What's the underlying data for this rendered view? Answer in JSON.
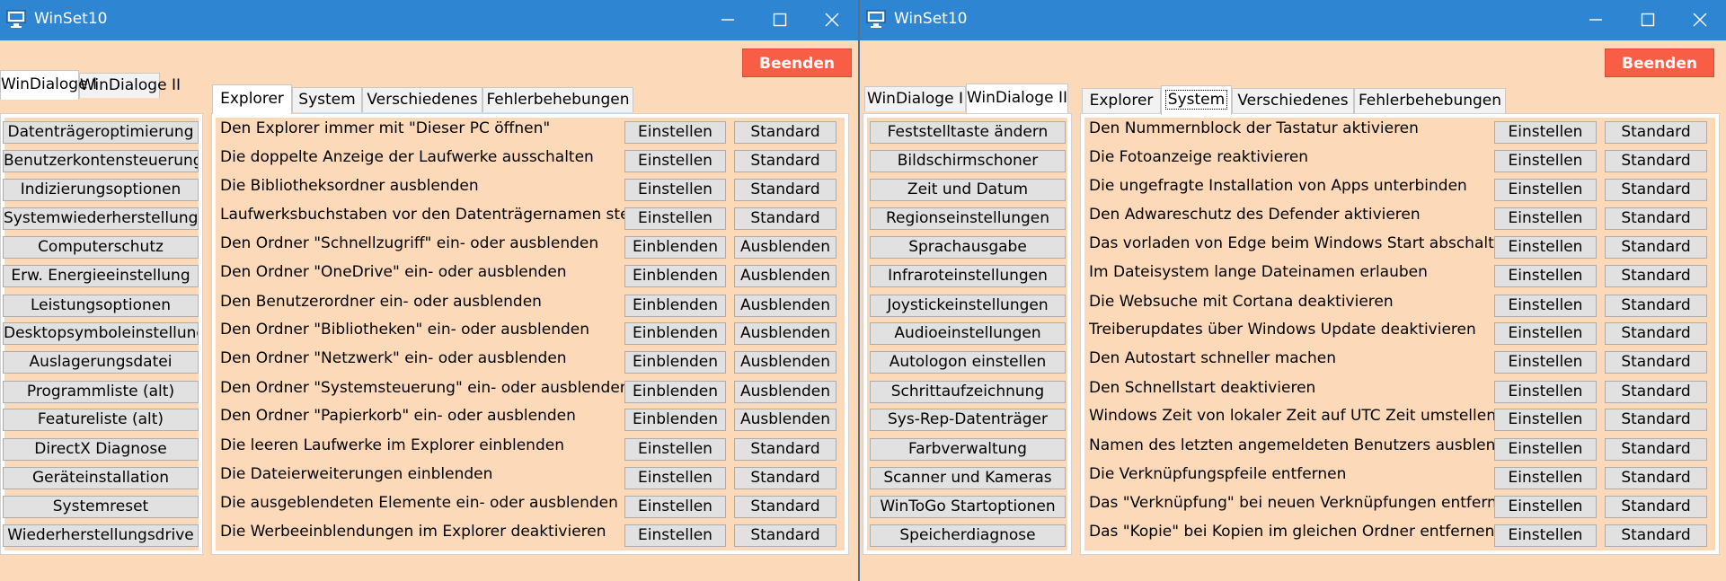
{
  "windows": [
    {
      "title": "WinSet10",
      "quit_label": "Beenden",
      "left_tabs": [
        "WinDialoge I",
        "WinDialoge II"
      ],
      "left_active": 0,
      "inner_tabs": [
        "Explorer",
        "System",
        "Verschiedenes",
        "Fehlerbehebungen"
      ],
      "inner_active": 0,
      "side_buttons": [
        "Datenträgeroptimierung",
        "Benutzerkontensteuerung",
        "Indizierungsoptionen",
        "Systemwiederherstellung",
        "Computerschutz",
        "Erw. Energieeinstellung",
        "Leistungsoptionen",
        "Desktopsymboleinstellung",
        "Auslagerungsdatei",
        "Programmliste (alt)",
        "Featureliste (alt)",
        "DirectX Diagnose",
        "Geräteinstallation",
        "Systemreset",
        "Wiederherstellungsdrive"
      ],
      "rows": [
        {
          "label": "Den Explorer immer mit \"Dieser PC öffnen\"",
          "btn1": "Einstellen",
          "btn2": "Standard"
        },
        {
          "label": "Die doppelte Anzeige der Laufwerke ausschalten",
          "btn1": "Einstellen",
          "btn2": "Standard"
        },
        {
          "label": "Die Bibliotheksordner ausblenden",
          "btn1": "Einstellen",
          "btn2": "Standard"
        },
        {
          "label": "Laufwerksbuchstaben vor den Datenträgernamen stellen",
          "btn1": "Einstellen",
          "btn2": "Standard"
        },
        {
          "label": "Den Ordner \"Schnellzugriff\" ein- oder ausblenden",
          "btn1": "Einblenden",
          "btn2": "Ausblenden"
        },
        {
          "label": "Den Ordner \"OneDrive\" ein- oder ausblenden",
          "btn1": "Einblenden",
          "btn2": "Ausblenden"
        },
        {
          "label": "Den Benutzerordner ein- oder ausblenden",
          "btn1": "Einblenden",
          "btn2": "Ausblenden"
        },
        {
          "label": "Den Ordner \"Bibliotheken\" ein- oder ausblenden",
          "btn1": "Einblenden",
          "btn2": "Ausblenden"
        },
        {
          "label": "Den Ordner \"Netzwerk\" ein- oder ausblenden",
          "btn1": "Einblenden",
          "btn2": "Ausblenden"
        },
        {
          "label": "Den Ordner \"Systemsteuerung\" ein- oder ausblenden",
          "btn1": "Einblenden",
          "btn2": "Ausblenden"
        },
        {
          "label": "Den Ordner \"Papierkorb\" ein- oder ausblenden",
          "btn1": "Einblenden",
          "btn2": "Ausblenden"
        },
        {
          "label": "Die leeren Laufwerke im Explorer einblenden",
          "btn1": "Einstellen",
          "btn2": "Standard"
        },
        {
          "label": "Die Dateierweiterungen einblenden",
          "btn1": "Einstellen",
          "btn2": "Standard"
        },
        {
          "label": "Die ausgeblendeten Elemente ein- oder ausblenden",
          "btn1": "Einstellen",
          "btn2": "Standard"
        },
        {
          "label": "Die Werbeeinblendungen im Explorer deaktivieren",
          "btn1": "Einstellen",
          "btn2": "Standard"
        }
      ]
    },
    {
      "title": "WinSet10",
      "quit_label": "Beenden",
      "left_tabs": [
        "WinDialoge I",
        "WinDialoge II"
      ],
      "left_active": 1,
      "inner_tabs": [
        "Explorer",
        "System",
        "Verschiedenes",
        "Fehlerbehebungen"
      ],
      "inner_active": 1,
      "side_buttons": [
        "Feststelltaste ändern",
        "Bildschirmschoner",
        "Zeit und Datum",
        "Regionseinstellungen",
        "Sprachausgabe",
        "Infraroteinstellungen",
        "Joystickeinstellungen",
        "Audioeinstellungen",
        "Autologon einstellen",
        "Schrittaufzeichnung",
        "Sys-Rep-Datenträger",
        "Farbverwaltung",
        "Scanner und Kameras",
        "WinToGo Startoptionen",
        "Speicherdiagnose"
      ],
      "rows": [
        {
          "label": "Den Nummernblock der Tastatur aktivieren",
          "btn1": "Einstellen",
          "btn2": "Standard"
        },
        {
          "label": "Die Fotoanzeige reaktivieren",
          "btn1": "Einstellen",
          "btn2": "Standard"
        },
        {
          "label": "Die ungefragte Installation von Apps unterbinden",
          "btn1": "Einstellen",
          "btn2": "Standard"
        },
        {
          "label": "Den Adwareschutz des Defender aktivieren",
          "btn1": "Einstellen",
          "btn2": "Standard"
        },
        {
          "label": "Das vorladen von Edge beim Windows Start abschalten",
          "btn1": "Einstellen",
          "btn2": "Standard"
        },
        {
          "label": "Im Dateisystem lange Dateinamen erlauben",
          "btn1": "Einstellen",
          "btn2": "Standard"
        },
        {
          "label": "Die Websuche mit Cortana deaktivieren",
          "btn1": "Einstellen",
          "btn2": "Standard"
        },
        {
          "label": "Treiberupdates über Windows Update deaktivieren",
          "btn1": "Einstellen",
          "btn2": "Standard"
        },
        {
          "label": "Den Autostart schneller machen",
          "btn1": "Einstellen",
          "btn2": "Standard"
        },
        {
          "label": "Den Schnellstart deaktivieren",
          "btn1": "Einstellen",
          "btn2": "Standard"
        },
        {
          "label": "Windows Zeit von lokaler Zeit auf UTC Zeit umstellen",
          "btn1": "Einstellen",
          "btn2": "Standard"
        },
        {
          "label": "Namen des letzten angemeldeten Benutzers ausblenden",
          "btn1": "Einstellen",
          "btn2": "Standard"
        },
        {
          "label": "Die Verknüpfungspfeile entfernen",
          "btn1": "Einstellen",
          "btn2": "Standard"
        },
        {
          "label": "Das \"Verknüpfung\" bei neuen Verknüpfungen entfernen",
          "btn1": "Einstellen",
          "btn2": "Standard"
        },
        {
          "label": "Das \"Kopie\" bei Kopien im gleichen Ordner entfernen",
          "btn1": "Einstellen",
          "btn2": "Standard"
        }
      ]
    }
  ],
  "icons": {
    "app": "monitor-icon",
    "minimize": "minimize-icon",
    "maximize": "maximize-icon",
    "close": "close-icon"
  },
  "colors": {
    "titlebar": "#2e86d2",
    "window_bg": "#fcd9b8",
    "quit_button": "#f85d45",
    "button_bg": "#e1e1e1"
  }
}
